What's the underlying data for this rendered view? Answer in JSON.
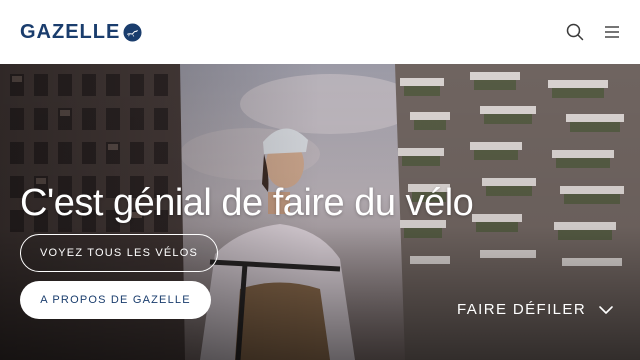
{
  "header": {
    "logo_text": "GAZELLE",
    "search_icon": "search-icon",
    "menu_icon": "hamburger-menu-icon"
  },
  "hero": {
    "headline": "C'est génial de faire du vélo",
    "buttons": [
      {
        "label": "VOYEZ TOUS LES VÉLOS",
        "style": "outline"
      },
      {
        "label": "A PROPOS DE GAZELLE",
        "style": "solid"
      }
    ],
    "scroll_label": "FAIRE DÉFILER",
    "scroll_icon": "chevron-down-icon"
  },
  "colors": {
    "brand": "#1a3d6d",
    "header_bg": "#ffffff",
    "hero_text": "#ffffff"
  }
}
